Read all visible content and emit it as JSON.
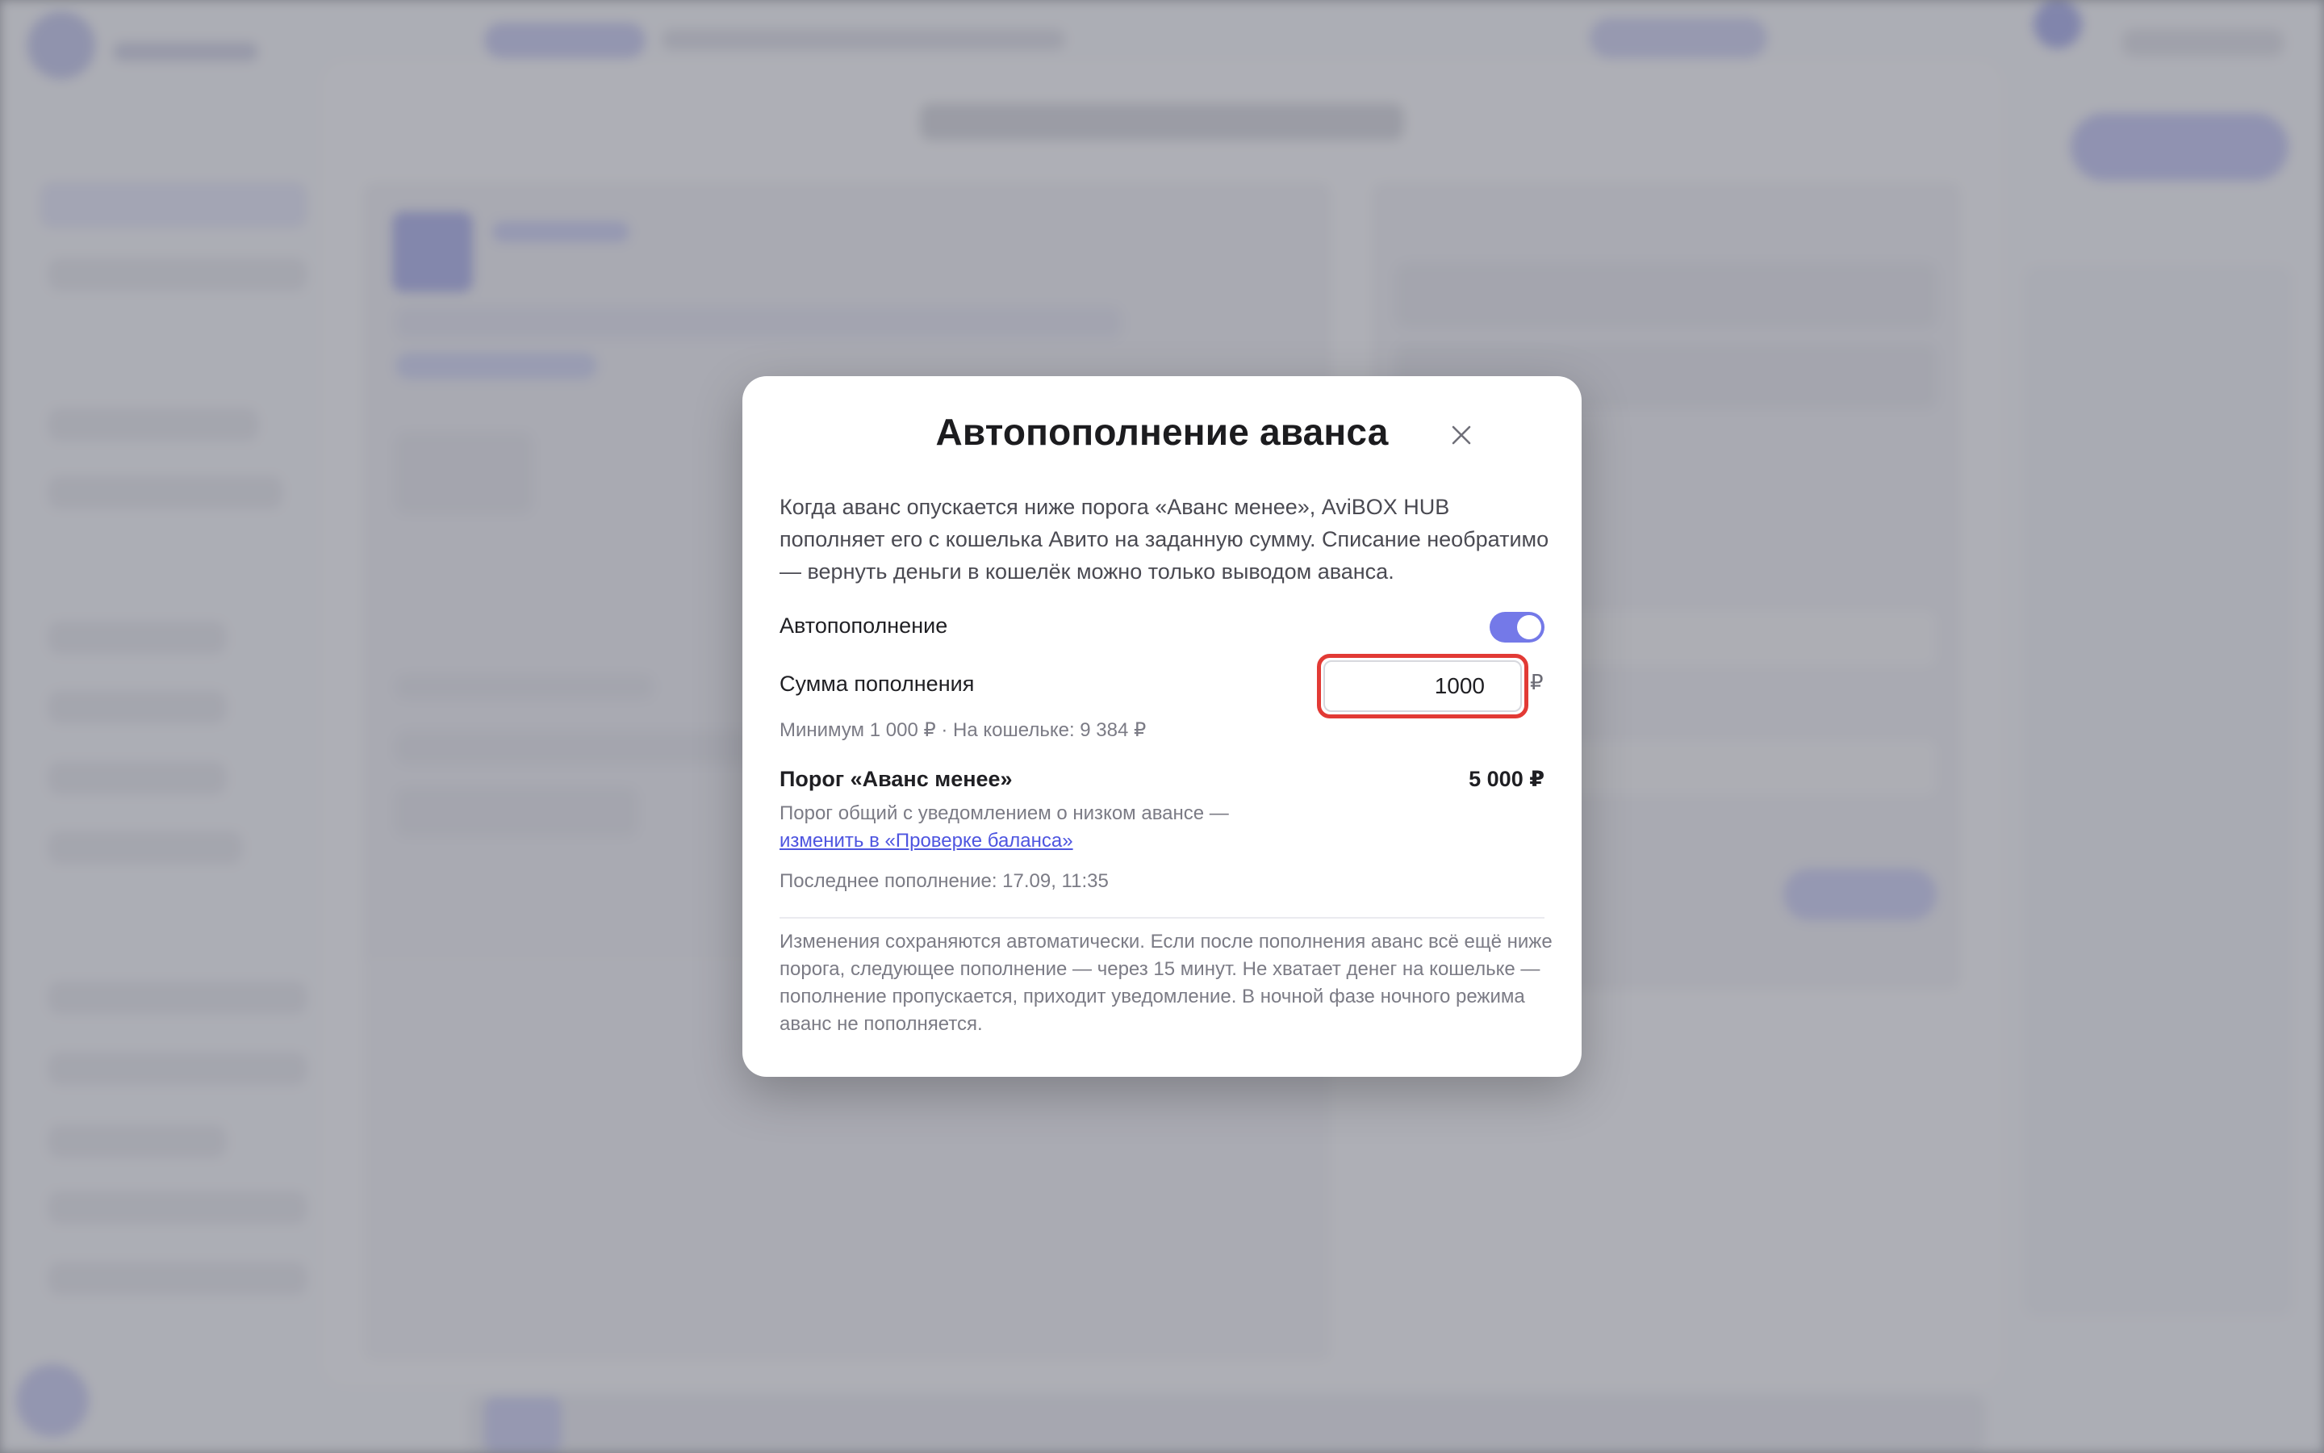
{
  "dialog": {
    "title": "Автопополнение аванса",
    "description": "Когда аванс опускается ниже порога «Аванс менее», AviBOX HUB пополняет его с кошелька Авито на заданную сумму. Списание необратимо — вернуть деньги в кошелёк можно только выводом аванса.",
    "autotopup": {
      "label": "Автопополнение",
      "enabled": true
    },
    "amount": {
      "label": "Сумма пополнения",
      "value": "1000",
      "currency": "₽",
      "hint": "Минимум 1 000 ₽ · На кошельке: 9 384 ₽"
    },
    "threshold": {
      "label": "Порог «Аванс менее»",
      "value": "5 000 ₽",
      "hint": "Порог общий с уведомлением о низком авансе —",
      "link": "изменить в «Проверке баланса»"
    },
    "last_topup": "Последнее пополнение: 17.09, 11:35",
    "footer_note": "Изменения сохраняются автоматически. Если после пополнения аванс всё ещё ниже порога, следующее пополнение — через 15 минут. Не хватает денег на кошельке — пополнение пропускается, приходит уведомление. В ночной фазе ночного режима аванс не пополняется."
  },
  "colors": {
    "accent": "#7479e8",
    "link": "#4e55e0",
    "highlight": "#e23a35"
  },
  "icons": {
    "close": "close-icon"
  }
}
